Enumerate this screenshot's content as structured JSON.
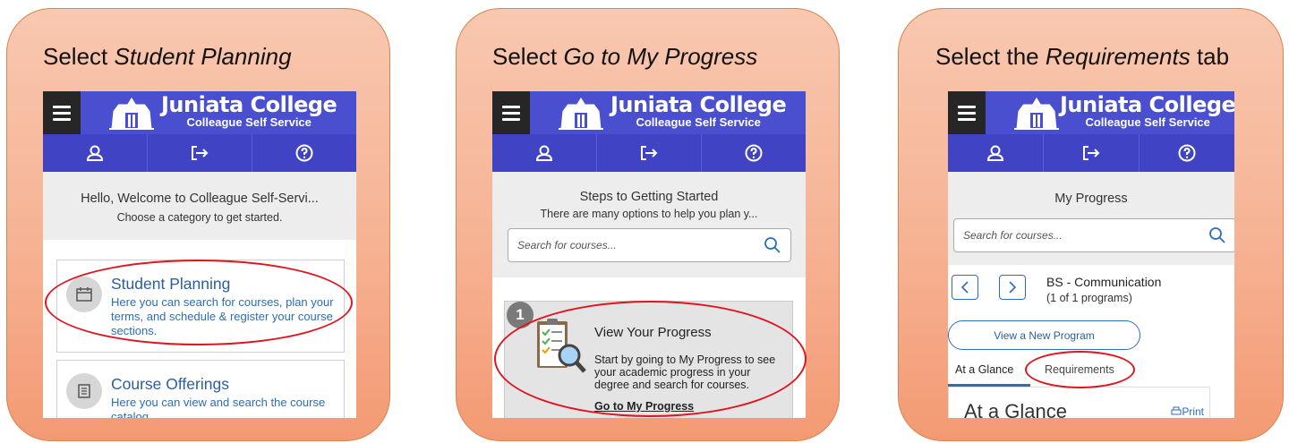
{
  "app": {
    "brand_title": "Juniata College",
    "brand_subtitle": "Colleague Self Service"
  },
  "panels": [
    {
      "instruction_prefix": "Select ",
      "instruction_italic": "Student Planning",
      "instruction_suffix": "",
      "welcome_line1": "Hello, Welcome to Colleague Self-Servi...",
      "welcome_line2": "Choose a category to get started.",
      "tiles": [
        {
          "title": "Student Planning",
          "description": "Here you can search for courses, plan your terms, and schedule & register your course sections."
        },
        {
          "title": "Course Offerings",
          "description": "Here you can view and search the course catalog."
        }
      ]
    },
    {
      "instruction_prefix": "Select ",
      "instruction_italic": "Go to My Progress",
      "instruction_suffix": "",
      "heading": "Steps to Getting Started",
      "subheading": "There are many options to help you plan y...",
      "search_placeholder": "Search for courses...",
      "step_number": "1",
      "step_title": "View Your Progress",
      "step_description": "Start by going to My Progress to see your academic progress in your degree and search for courses.",
      "step_link": "Go to My Progress"
    },
    {
      "instruction_prefix": "Select the ",
      "instruction_italic": "Requirements",
      "instruction_suffix": " tab",
      "heading": "My Progress",
      "search_placeholder": "Search for courses...",
      "program_name": "BS - Communication",
      "program_count": "(1 of 1 programs)",
      "view_program_button": "View a New Program",
      "tabs": [
        "At a Glance",
        "Requirements"
      ],
      "section_title": "At a Glance",
      "print_label": "Print"
    }
  ],
  "icons": [
    "menu-icon",
    "user-icon",
    "sign-out-icon",
    "help-icon",
    "search-icon",
    "calendar-icon",
    "book-icon",
    "checklist-icon",
    "chevron-left-icon",
    "chevron-right-icon",
    "print-icon"
  ],
  "colors": {
    "header": "#4a4fd0",
    "nav": "#3f43c4",
    "card_top": "#f8c8b0",
    "card_bottom": "#f39a73",
    "highlight_oval": "#e1141e",
    "link": "#2a6ebc"
  }
}
